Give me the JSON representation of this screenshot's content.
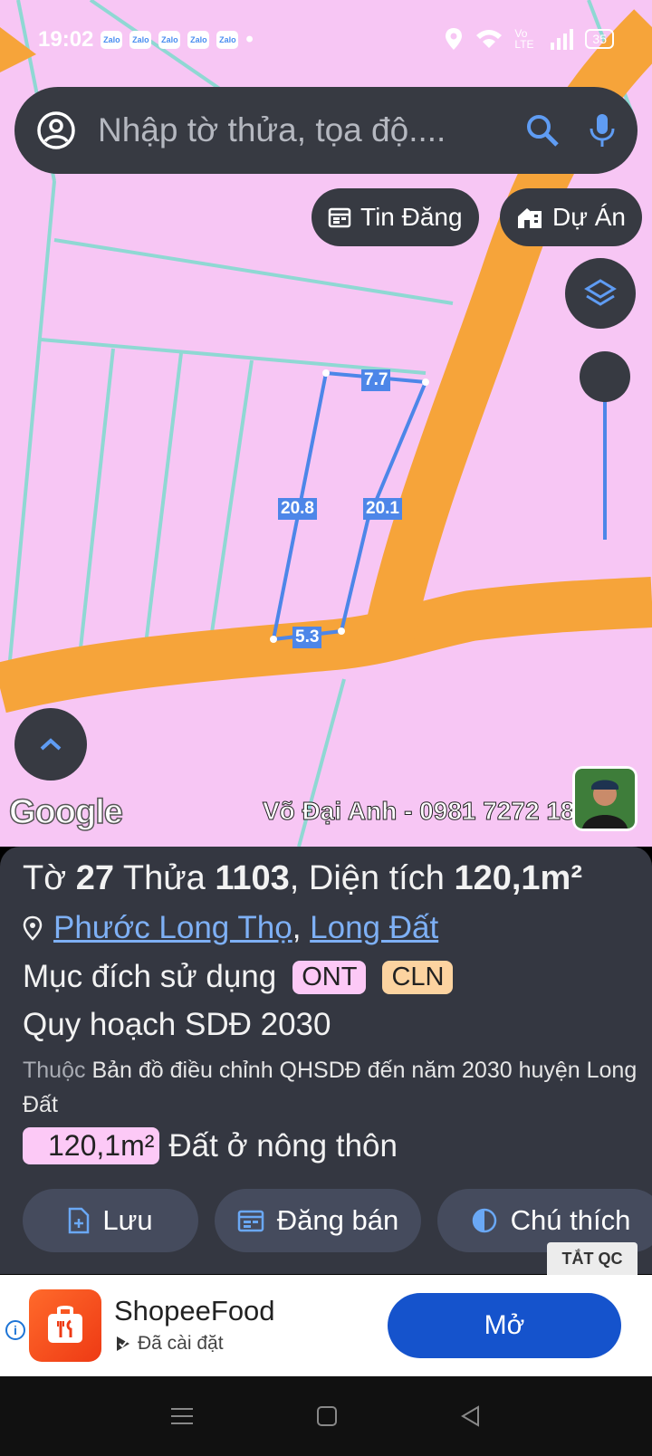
{
  "status_bar": {
    "time": "19:02",
    "notifications": [
      "Zalo",
      "Zalo",
      "Zalo",
      "Zalo",
      "Zalo"
    ],
    "network": "Vo LTE",
    "battery": "35"
  },
  "search": {
    "placeholder": "Nhập tờ thửa, tọa độ...."
  },
  "chips": {
    "listings": "Tin Đăng",
    "projects": "Dự Án"
  },
  "map": {
    "dimensions": [
      "7.7",
      "20.8",
      "20.1",
      "5.3"
    ],
    "provider": "Google",
    "watermark": "Võ Đại Anh - 0981 7272 18",
    "colors": {
      "land": "#f7c6f4",
      "road": "#f6a43a",
      "parcel_line": "#8fd8d3",
      "selection": "#4d86e8"
    }
  },
  "parcel": {
    "title_prefix": "Tờ",
    "sheet": "27",
    "plot_label": "Thửa",
    "plot": "1103",
    "area_label": ", Diện tích",
    "area": "120,1m²",
    "ward": "Phước Long Thọ",
    "district": "Long Đất",
    "purpose_label": "Mục đích sử dụng",
    "purposes": [
      "ONT",
      "CLN"
    ],
    "plan_title": "Quy hoạch SDĐ 2030",
    "plan_desc_prefix": "Thuộc",
    "plan_desc": "Bản đồ điều chỉnh QHSDĐ đến năm 2030 huyện Long Đất",
    "zone_area": "120,1m²",
    "zone_name": "Đất ở nông thôn"
  },
  "actions": {
    "save": "Lưu",
    "sell": "Đăng bán",
    "legend": "Chú thích"
  },
  "ad": {
    "close": "TẮT QC",
    "app_name": "ShopeeFood",
    "status": "Đã cài đặt",
    "open": "Mở"
  }
}
